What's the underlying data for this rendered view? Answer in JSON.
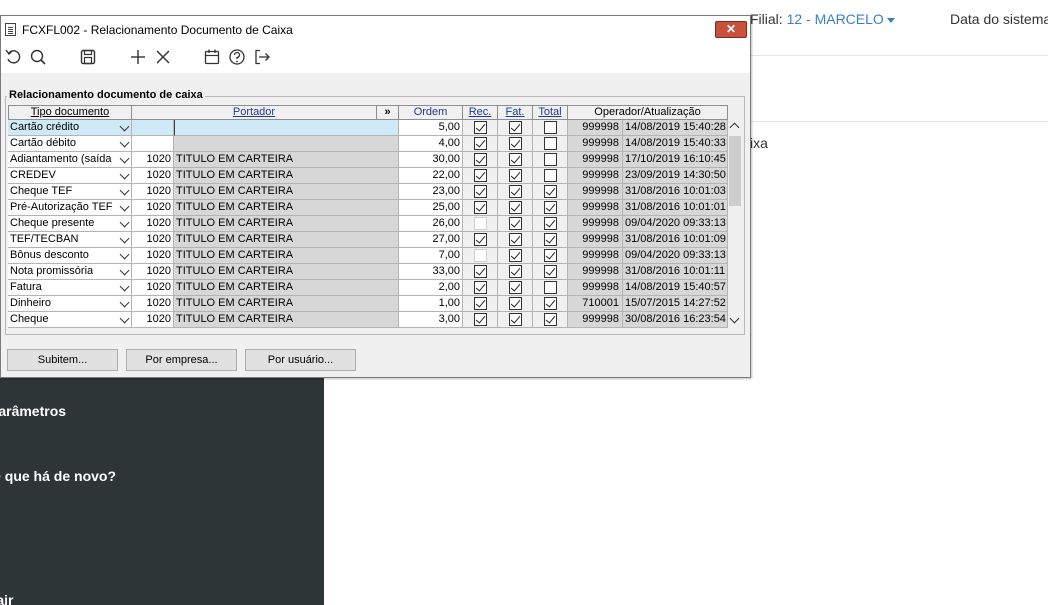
{
  "background": {
    "filial_label": "Filial:",
    "filial_value": "12 - MARCELO",
    "date_label": "Data do sistema",
    "cut_text": "ixa",
    "sidebar_items": [
      "Parâmetros",
      "O que há de novo?",
      "Sair"
    ]
  },
  "window": {
    "title": "FCXFL002 - Relacionamento Documento de Caixa",
    "close_label": "✕",
    "group_label": "Relacionamento documento de caixa"
  },
  "toolbar": [
    "undo-icon",
    "search-icon",
    "save-icon",
    "add-icon",
    "delete-icon",
    "calendar-icon",
    "help-icon",
    "exit-icon"
  ],
  "columns": {
    "tipo": "Tipo documento",
    "portador": "Portador",
    "expand": "»",
    "ordem": "Ordem",
    "rec": "Rec.",
    "fat": "Fat.",
    "total": "Total",
    "operador": "Operador/Atualização"
  },
  "rows": [
    {
      "tipo": "Cartão crédito",
      "pcode": "",
      "pname": "",
      "ordem": "5,00",
      "rec": true,
      "fat": true,
      "tot": false,
      "opid": "999998",
      "opdt": "14/08/2019 15:40:28",
      "selected": true
    },
    {
      "tipo": "Cartão débito",
      "pcode": "",
      "pname": "",
      "ordem": "4,00",
      "rec": true,
      "fat": true,
      "tot": false,
      "opid": "999998",
      "opdt": "14/08/2019 15:40:33"
    },
    {
      "tipo": "Adiantamento (saída",
      "pcode": "1020",
      "pname": "TITULO EM CARTEIRA",
      "ordem": "30,00",
      "rec": true,
      "fat": true,
      "tot": false,
      "opid": "999998",
      "opdt": "17/10/2019 16:10:45"
    },
    {
      "tipo": "CREDEV",
      "pcode": "1020",
      "pname": "TITULO EM CARTEIRA",
      "ordem": "22,00",
      "rec": true,
      "fat": true,
      "tot": false,
      "opid": "999998",
      "opdt": "23/09/2019 14:30:50"
    },
    {
      "tipo": "Cheque TEF",
      "pcode": "1020",
      "pname": "TITULO EM CARTEIRA",
      "ordem": "23,00",
      "rec": true,
      "fat": true,
      "tot": true,
      "opid": "999998",
      "opdt": "31/08/2016 10:01:03"
    },
    {
      "tipo": "Pré-Autorização TEF",
      "pcode": "1020",
      "pname": "TITULO EM CARTEIRA",
      "ordem": "25,00",
      "rec": true,
      "fat": true,
      "tot": true,
      "opid": "999998",
      "opdt": "31/08/2016 10:01:01"
    },
    {
      "tipo": "Cheque presente",
      "pcode": "1020",
      "pname": "TITULO EM CARTEIRA",
      "ordem": "26,00",
      "rec": null,
      "fat": true,
      "tot": true,
      "opid": "999998",
      "opdt": "09/04/2020 09:33:13"
    },
    {
      "tipo": "TEF/TECBAN",
      "pcode": "1020",
      "pname": "TITULO EM CARTEIRA",
      "ordem": "27,00",
      "rec": true,
      "fat": true,
      "tot": true,
      "opid": "999998",
      "opdt": "31/08/2016 10:01:09"
    },
    {
      "tipo": "Bônus desconto",
      "pcode": "1020",
      "pname": "TITULO EM CARTEIRA",
      "ordem": "7,00",
      "rec": null,
      "fat": true,
      "tot": true,
      "opid": "999998",
      "opdt": "09/04/2020 09:33:13"
    },
    {
      "tipo": "Nota promissória",
      "pcode": "1020",
      "pname": "TITULO EM CARTEIRA",
      "ordem": "33,00",
      "rec": true,
      "fat": true,
      "tot": true,
      "opid": "999998",
      "opdt": "31/08/2016 10:01:11"
    },
    {
      "tipo": "Fatura",
      "pcode": "1020",
      "pname": "TITULO EM CARTEIRA",
      "ordem": "2,00",
      "rec": true,
      "fat": true,
      "tot": false,
      "opid": "999998",
      "opdt": "14/08/2019 15:40:57"
    },
    {
      "tipo": "Dinheiro",
      "pcode": "1020",
      "pname": "TITULO EM CARTEIRA",
      "ordem": "1,00",
      "rec": true,
      "fat": true,
      "tot": true,
      "opid": "710001",
      "opdt": "15/07/2015 14:27:52"
    },
    {
      "tipo": "Cheque",
      "pcode": "1020",
      "pname": "TITULO EM CARTEIRA",
      "ordem": "3,00",
      "rec": true,
      "fat": true,
      "tot": true,
      "opid": "999998",
      "opdt": "30/08/2016 16:23:54"
    }
  ],
  "buttons": {
    "subitem": "Subitem...",
    "empresa": "Por empresa...",
    "usuario": "Por usuário..."
  },
  "colors": {
    "sidebar_bg": "#2e3537",
    "accent": "#3a7fc4",
    "close_bg": "#c9513a",
    "selected_row": "#cfe9f6",
    "header_blue": "#1c3b94"
  }
}
